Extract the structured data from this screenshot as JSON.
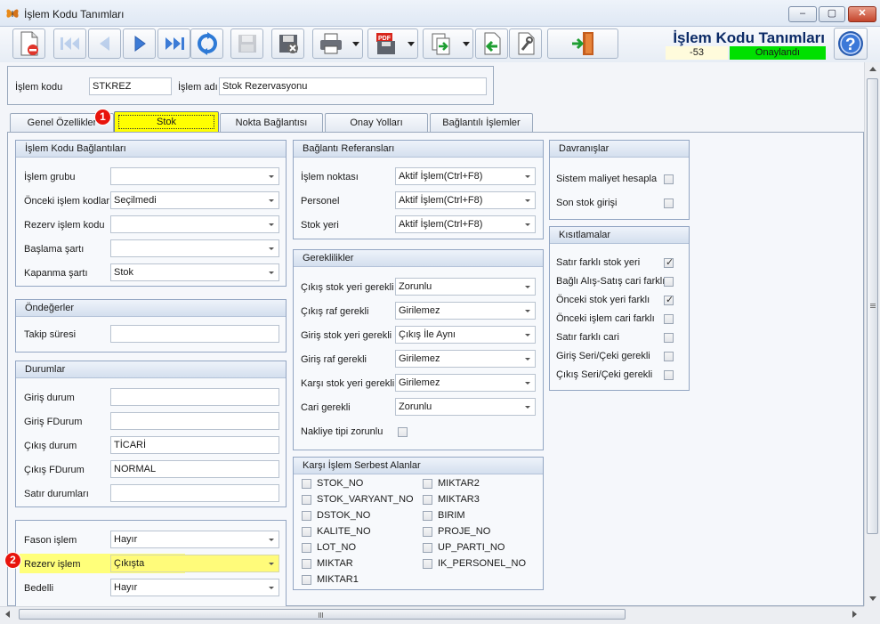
{
  "window": {
    "title": "İşlem Kodu Tanımları",
    "minimize": "–",
    "maximize": "▢",
    "close": "✕"
  },
  "header": {
    "title": "İşlem Kodu Tanımları",
    "record_no": "-53",
    "status": "Onaylandı",
    "status_color": "#00e000"
  },
  "toolbar": {
    "icons": [
      "new-document-icon",
      "first-record-icon",
      "previous-record-icon",
      "next-record-icon",
      "last-record-icon",
      "refresh-icon",
      "save-icon",
      "cancel-save-icon",
      "print-icon",
      "pdf-export-icon",
      "export-icon",
      "import-icon",
      "tools-icon",
      "exit-door-icon",
      "help-icon"
    ]
  },
  "code": {
    "kod_label": "İşlem kodu",
    "kod_value": "STKREZ",
    "ad_label": "İşlem adı",
    "ad_value": "Stok Rezervasyonu"
  },
  "tabs": [
    "Genel Özellikler",
    "Stok",
    "Nokta Bağlantısı",
    "Onay Yolları",
    "Bağlantılı İşlemler"
  ],
  "badges": {
    "tab": "1",
    "field": "2"
  },
  "baglantilar": {
    "title": "İşlem Kodu Bağlantıları",
    "rows": [
      {
        "label": "İşlem grubu",
        "value": ""
      },
      {
        "label": "Önceki işlem kodları",
        "value": "Seçilmedi"
      },
      {
        "label": "Rezerv işlem kodu",
        "value": ""
      },
      {
        "label": "Başlama şartı",
        "value": ""
      },
      {
        "label": "Kapanma şartı",
        "value": "Stok"
      }
    ]
  },
  "ondegerler": {
    "title": "Öndeğerler",
    "takip_label": "Takip süresi",
    "takip_value": ""
  },
  "durumlar": {
    "title": "Durumlar",
    "rows": [
      {
        "label": "Giriş durum",
        "value": ""
      },
      {
        "label": "Giriş FDurum",
        "value": ""
      },
      {
        "label": "Çıkış durum",
        "value": "TİCARİ"
      },
      {
        "label": "Çıkış FDurum",
        "value": "NORMAL"
      },
      {
        "label": "Satır durumları",
        "value": ""
      }
    ]
  },
  "fason": {
    "rows": [
      {
        "label": "Fason işlem",
        "value": "Hayır"
      },
      {
        "label": "Rezerv işlem",
        "value": "Çıkışta"
      },
      {
        "label": "Bedelli",
        "value": "Hayır"
      }
    ]
  },
  "referanslar": {
    "title": "Bağlantı Referansları",
    "rows": [
      {
        "label": "İşlem noktası",
        "value": "Aktif İşlem(Ctrl+F8)"
      },
      {
        "label": "Personel",
        "value": "Aktif İşlem(Ctrl+F8)"
      },
      {
        "label": "Stok yeri",
        "value": "Aktif İşlem(Ctrl+F8)"
      }
    ]
  },
  "gereklilikler": {
    "title": "Gereklilikler",
    "rows": [
      {
        "label": "Çıkış stok yeri gerekli",
        "value": "Zorunlu"
      },
      {
        "label": "Çıkış raf gerekli",
        "value": "Girilemez"
      },
      {
        "label": "Giriş stok yeri gerekli",
        "value": "Çıkış İle Aynı"
      },
      {
        "label": "Giriş raf gerekli",
        "value": "Girilemez"
      },
      {
        "label": "Karşı stok yeri gerekli",
        "value": "Girilemez"
      },
      {
        "label": "Cari gerekli",
        "value": "Zorunlu"
      }
    ],
    "nakliye_label": "Nakliye tipi zorunlu"
  },
  "serbest": {
    "title": "Karşı İşlem Serbest Alanlar",
    "left": [
      "STOK_NO",
      "STOK_VARYANT_NO",
      "DSTOK_NO",
      "KALITE_NO",
      "LOT_NO",
      "MIKTAR",
      "MIKTAR1"
    ],
    "right": [
      "MIKTAR2",
      "MIKTAR3",
      "BIRIM",
      "PROJE_NO",
      "UP_PARTI_NO",
      "IK_PERSONEL_NO"
    ]
  },
  "davranislar": {
    "title": "Davranışlar",
    "items": [
      {
        "label": "Sistem maliyet hesapla",
        "checked": false
      },
      {
        "label": "Son stok girişi",
        "checked": false
      }
    ]
  },
  "kisitlamalar": {
    "title": "Kısıtlamalar",
    "items": [
      {
        "label": "Satır farklı stok yeri",
        "checked": true
      },
      {
        "label": "Bağlı Alış-Satış cari farklı",
        "checked": false
      },
      {
        "label": "Önceki stok yeri farklı",
        "checked": true
      },
      {
        "label": "Önceki işlem cari farklı",
        "checked": false
      },
      {
        "label": "Satır farklı cari",
        "checked": false
      },
      {
        "label": "Giriş Seri/Çeki gerekli",
        "checked": false
      },
      {
        "label": "Çıkış Seri/Çeki gerekli",
        "checked": false
      }
    ]
  },
  "highlight_color": "#ffff00"
}
